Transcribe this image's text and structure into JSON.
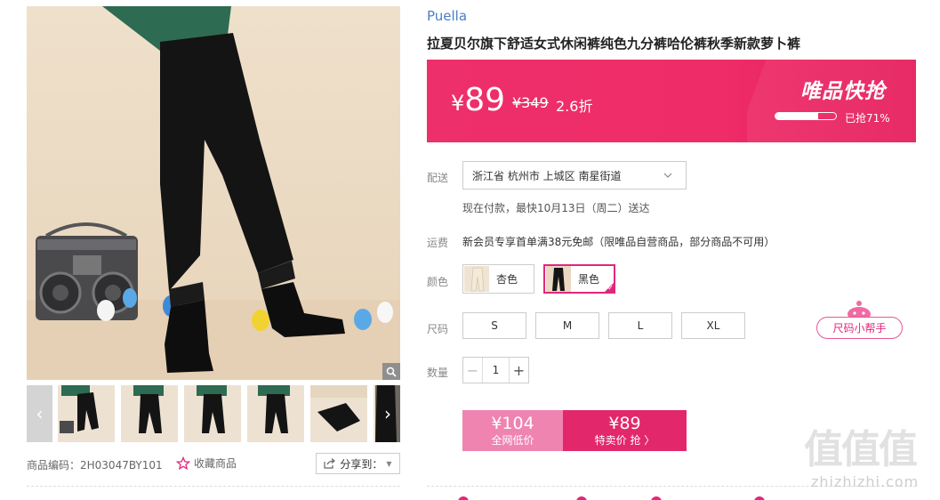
{
  "product": {
    "brand": "Puella",
    "title": "拉夏贝尔旗下舒适女式休闲裤纯色九分裤哈伦裤秋季新款萝卜裤"
  },
  "price": {
    "yen_symbol": "¥",
    "current": "89",
    "original": "¥349",
    "discount": "2.6折",
    "promo_title": "唯品快抢",
    "sold_text": "已抢71%",
    "sold_fraction": 0.71
  },
  "delivery": {
    "label": "配送",
    "address": "浙江省 杭州市 上城区 南星街道",
    "note": "现在付款，最快10月13日（周二）送达"
  },
  "freight": {
    "label": "运费",
    "text": "新会员专享首单满38元免邮（限唯品自营商品，部分商品不可用）"
  },
  "color": {
    "label": "颜色",
    "options": [
      {
        "name": "杏色",
        "selected": false
      },
      {
        "name": "黑色",
        "selected": true
      }
    ]
  },
  "size": {
    "label": "尺码",
    "options": [
      "S",
      "M",
      "L",
      "XL"
    ],
    "helper": "尺码小帮手"
  },
  "quantity": {
    "label": "数量",
    "minus": "−",
    "value": "1",
    "plus": "+"
  },
  "buy": {
    "normal_price": "¥104",
    "normal_label": "全网低价",
    "special_price": "¥89",
    "special_label": "特卖价 抢 〉"
  },
  "meta": {
    "sku": "商品编码：2H03047BY101",
    "favorite": "收藏商品",
    "share": "分享到："
  },
  "watermark": {
    "glyphs": "值值值",
    "url": "zhizhizhi.com"
  },
  "colors": {
    "accent": "#e2267e",
    "banner": "#ed2f6b",
    "brand_link": "#4a7fc1"
  }
}
